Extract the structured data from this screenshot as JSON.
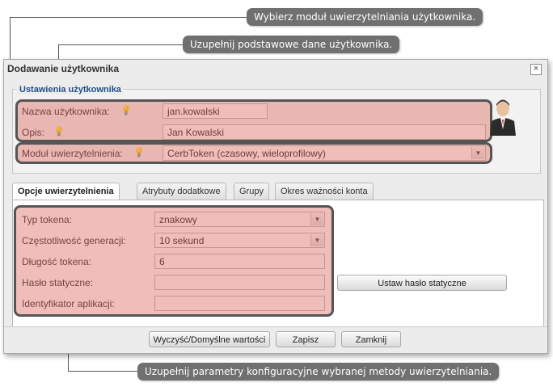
{
  "callouts": {
    "module": "Wybierz moduł uwierzytelniania użytkownika.",
    "basic": "Uzupełnij podstawowe dane użytkownika.",
    "params": "Uzupełnij parametry konfiguracyjne wybranej metody uwierzytelniania."
  },
  "dialog": {
    "title": "Dodawanie użytkownika",
    "close": "×",
    "legend": "Ustawienia użytkownika"
  },
  "user": {
    "username_label": "Nazwa użytkownika:",
    "username_value": "jan.kowalski",
    "description_label": "Opis:",
    "description_value": "Jan Kowalski",
    "module_label": "Moduł uwierzytelnienia:",
    "module_value": "CerbToken (czasowy, wieloprofilowy)"
  },
  "tabs": [
    {
      "label": "Opcje uwierzytelnienia"
    },
    {
      "label": "Atrybuty dodatkowe"
    },
    {
      "label": "Grupy"
    },
    {
      "label": "Okres ważności konta"
    }
  ],
  "options": {
    "token_type_label": "Typ tokena:",
    "token_type_value": "znakowy",
    "frequency_label": "Częstotliwość generacji:",
    "frequency_value": "10 sekund",
    "length_label": "Długość tokena:",
    "length_value": "6",
    "static_pw_label": "Hasło statyczne:",
    "static_pw_value": "",
    "app_id_label": "Identyfikator aplikacji:",
    "app_id_value": "",
    "set_static_btn": "Ustaw hasło statyczne"
  },
  "footer": {
    "reset": "Wyczyść/Domyślne wartości",
    "save": "Zapisz",
    "close": "Zamknij"
  }
}
